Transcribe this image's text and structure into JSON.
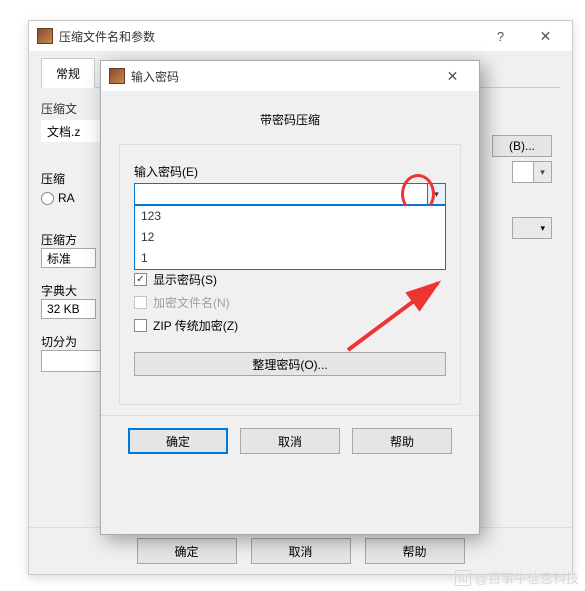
{
  "mainDialog": {
    "title": "压缩文件名和参数",
    "tabs": {
      "general": "常规"
    },
    "archiveNameLabel": "压缩文",
    "archiveNameValue": "文档.z",
    "browseLabel": "(B)...",
    "formatLabel": "压缩",
    "radioRar": "RA",
    "methodLabel": "压缩方",
    "methodValue": "标准",
    "dictLabel": "字典大",
    "dictValue": "32 KB",
    "splitLabel": "切分为",
    "buttons": {
      "ok": "确定",
      "cancel": "取消",
      "help": "帮助"
    }
  },
  "passwordDialog": {
    "title": "输入密码",
    "innerTitle": "带密码压缩",
    "passwordLabel": "输入密码(E)",
    "options": [
      "123",
      "12",
      "1"
    ],
    "showPassword": "显示密码(S)",
    "encryptNames": "加密文件名(N)",
    "zipLegacy": "ZIP 传统加密(Z)",
    "organize": "整理密码(O)...",
    "buttons": {
      "ok": "确定",
      "cancel": "取消",
      "help": "帮助"
    }
  },
  "watermark": "@百事牛信息科技"
}
